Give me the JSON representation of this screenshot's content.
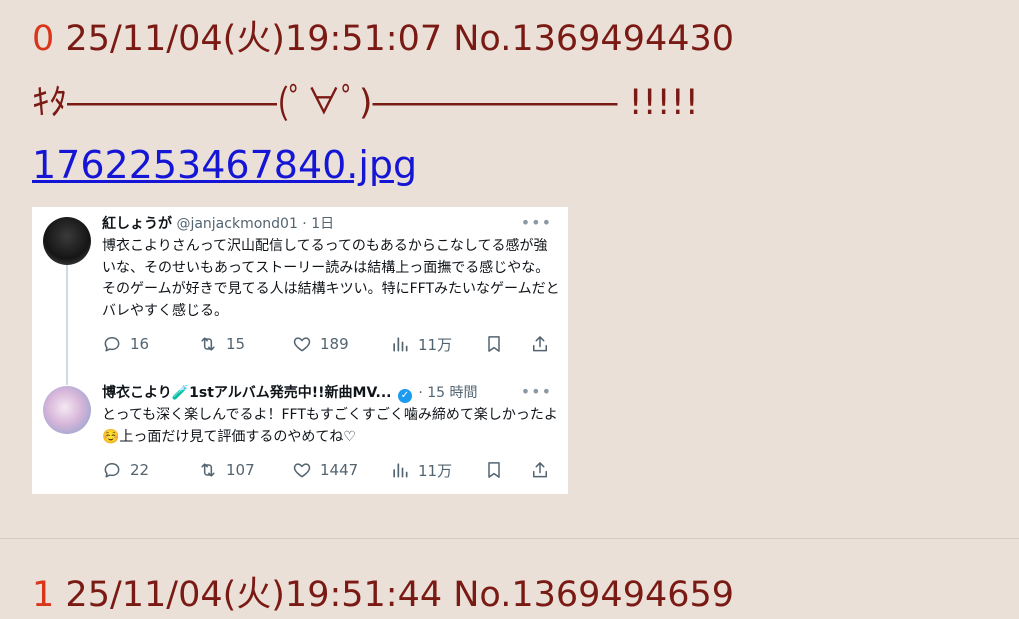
{
  "posts": [
    {
      "index": "0",
      "header": "25/11/04(火)19:51:07 No.1369494430",
      "body": "ｷﾀ――――――(ﾟ∀ﾟ)――――――― !!!!!",
      "file_link": "1762253467840.jpg"
    },
    {
      "index": "1",
      "header": "25/11/04(火)19:51:44 No.1369494659"
    }
  ],
  "tweets": [
    {
      "name": "紅しょうが",
      "handle": "@janjackmond01 · 1日",
      "more": "•••",
      "text": "博衣こよりさんって沢山配信してるってのもあるからこなしてる感が強いな、そのせいもあってストーリー読みは結構上っ面撫でる感じやな。そのゲームが好きで見てる人は結構キツい。特にFFTみたいなゲームだとバレやすく感じる。",
      "replies": "16",
      "retweets": "15",
      "likes": "189",
      "views": "11万"
    },
    {
      "name": "博衣こより🧪1stアルバム発売中!!新曲MV...",
      "verified_mark": "✓",
      "handle": "· 15 時間",
      "more": "•••",
      "text": "とっても深く楽しんでるよ！FFTもすごくすごく噛み締めて楽しかったよ☺️上っ面だけ見て評価するのやめてね♡",
      "replies": "22",
      "retweets": "107",
      "likes": "1447",
      "views": "11万"
    }
  ],
  "colors": {
    "background": "#ebe0d7",
    "header_text": "#7a1a14",
    "index_number": "#d8361a",
    "link": "#1515d6",
    "verified": "#1d9bf0"
  },
  "icons": [
    "reply-icon",
    "retweet-icon",
    "like-icon",
    "views-icon",
    "bookmark-icon",
    "share-icon",
    "verified-icon",
    "more-icon"
  ]
}
